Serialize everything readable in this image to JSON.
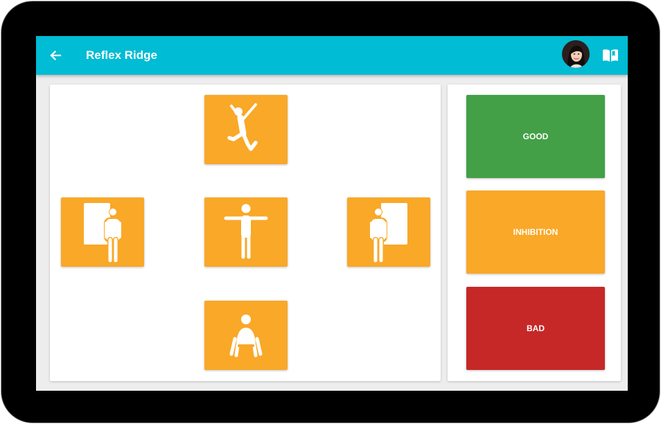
{
  "app": {
    "title": "Reflex Ridge",
    "back_icon": "arrow-left-icon",
    "profile_icon": "user-avatar",
    "guide_icon": "open-book-icon",
    "header_color": "#00bcd4"
  },
  "reflex_tiles": [
    {
      "id": "jump",
      "icon": "jumping-figure-icon"
    },
    {
      "id": "left-wall",
      "icon": "figure-wall-left-icon"
    },
    {
      "id": "t-pose",
      "icon": "t-pose-figure-icon"
    },
    {
      "id": "right-wall",
      "icon": "figure-wall-right-icon"
    },
    {
      "id": "squat",
      "icon": "squatting-figure-icon"
    }
  ],
  "assessment": {
    "good_label": "GOOD",
    "inhibition_label": "INHIBITION",
    "bad_label": "BAD",
    "colors": {
      "good": "#43a047",
      "inhibition": "#f9a828",
      "bad": "#c62828",
      "tile": "#f9a828"
    }
  }
}
